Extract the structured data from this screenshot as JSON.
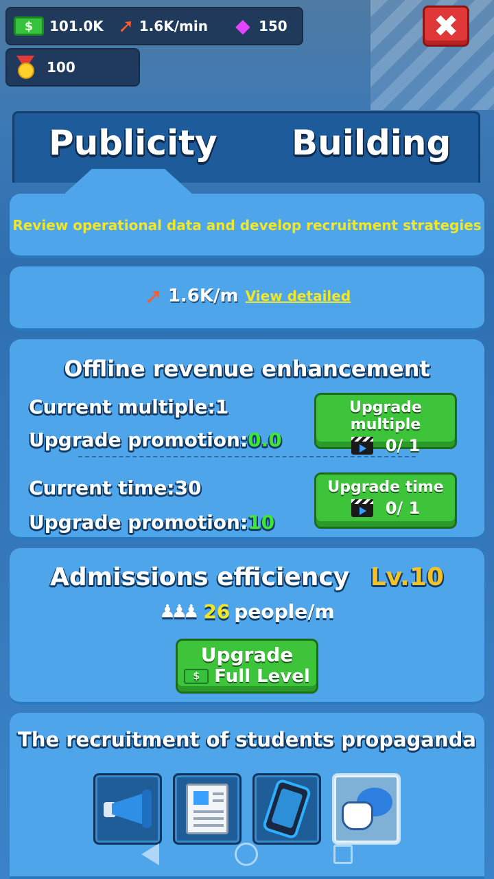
{
  "resources": {
    "cash": {
      "icon": "cash-icon",
      "glyph": "$",
      "value": "101.0K"
    },
    "income": {
      "icon": "arrow-up-icon",
      "value": "1.6K/min"
    },
    "gems": {
      "icon": "gem-icon",
      "value": "150"
    },
    "medals": {
      "icon": "medal-icon",
      "value": "100"
    }
  },
  "close": {
    "icon": "close-icon",
    "glyph": "✖"
  },
  "tabs": [
    {
      "label": "Publicity",
      "active": true
    },
    {
      "label": "Building",
      "active": false
    }
  ],
  "description": "Review operational data and develop recruitment strategies",
  "rate": {
    "value": "1.6K/m",
    "link": "View detailed"
  },
  "offline": {
    "title": "Offline revenue enhancement",
    "multiple": {
      "current_label": "Current multiple:",
      "current_value": "1",
      "promo_label": "Upgrade promotion:",
      "promo_value": "0.0",
      "button": "Upgrade multiple",
      "progress": "0/ 1"
    },
    "time": {
      "current_label": "Current time:",
      "current_value": "30",
      "promo_label": "Upgrade promotion:",
      "promo_value": "10",
      "button": "Upgrade time",
      "progress": "0/ 1"
    }
  },
  "admissions": {
    "title": "Admissions efficiency",
    "level": "Lv.10",
    "people_value": "26",
    "people_unit": "people/m",
    "button_line1": "Upgrade",
    "button_line2": "Full Level",
    "cash_glyph": "$"
  },
  "propaganda": {
    "title": "The recruitment of students propaganda",
    "items": [
      {
        "icon": "megaphone-icon",
        "selected": false
      },
      {
        "icon": "newspaper-icon",
        "selected": false
      },
      {
        "icon": "phone-icon",
        "selected": false
      },
      {
        "icon": "chat-bubble-icon",
        "selected": true
      }
    ]
  },
  "colors": {
    "background": "#2f74b8",
    "panel": "#4ea5ea",
    "accent_yellow": "#f2e628",
    "button_green": "#3ec43a",
    "close_red": "#e03838"
  }
}
